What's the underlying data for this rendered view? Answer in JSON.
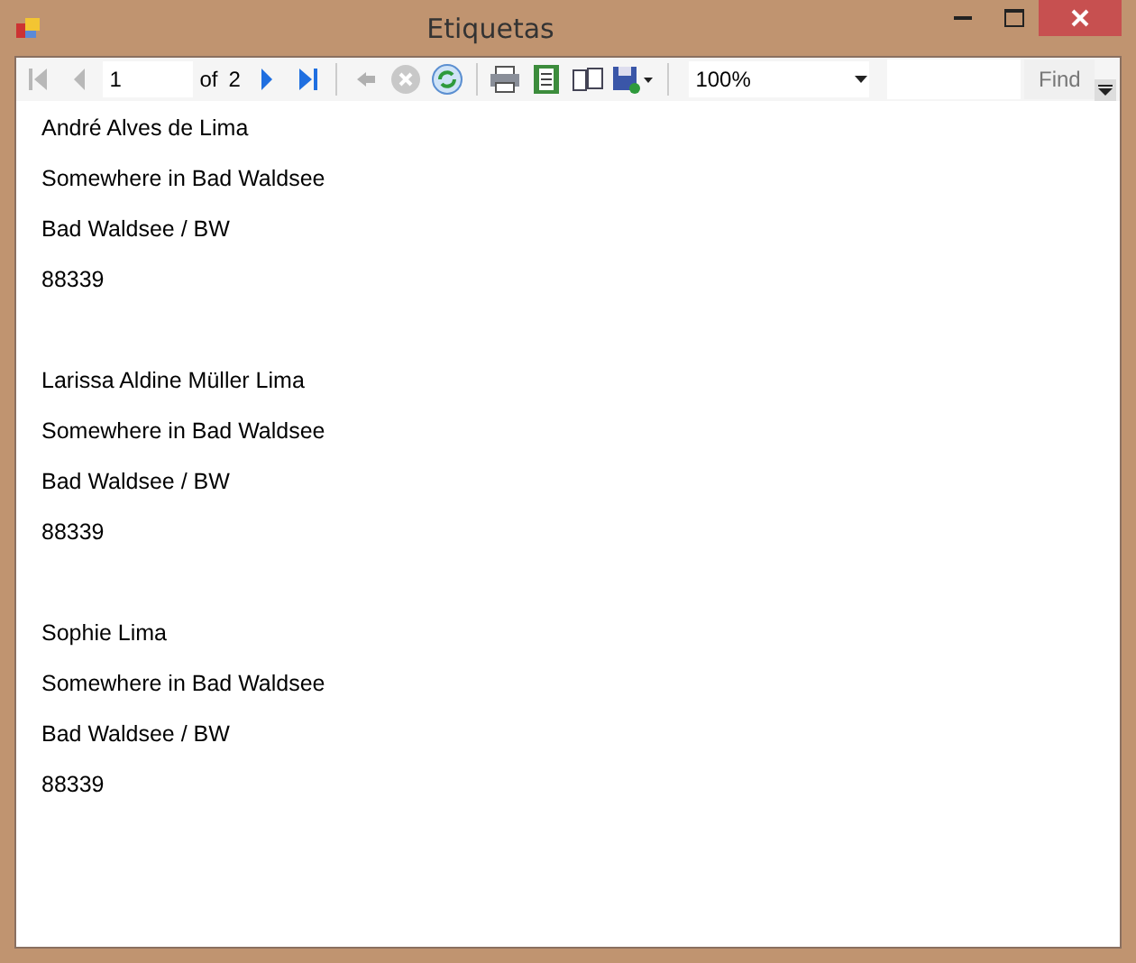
{
  "window": {
    "title": "Etiquetas"
  },
  "toolbar": {
    "nav_buttons": [
      {
        "kind": "first",
        "disabled": true
      },
      {
        "kind": "prev",
        "disabled": true
      }
    ],
    "page": {
      "value": "1",
      "of_label": "of",
      "count": "2"
    },
    "nav_buttons_after": [
      {
        "kind": "next",
        "disabled": false
      },
      {
        "kind": "last",
        "disabled": false
      }
    ],
    "action_buttons": [
      {
        "kind": "back",
        "disabled": true
      },
      {
        "kind": "stop",
        "disabled": true
      },
      {
        "kind": "refresh",
        "disabled": false
      }
    ],
    "zoom": {
      "value": "100%"
    },
    "find_button": "Find"
  },
  "labels": [
    {
      "lines": [
        "André Alves de Lima",
        "Somewhere in Bad Waldsee",
        "Bad Waldsee / BW",
        "88339"
      ]
    },
    {
      "lines": [
        "Larissa Aldine Müller Lima",
        "Somewhere in Bad Waldsee",
        "Bad Waldsee / BW",
        "88339"
      ]
    },
    {
      "lines": [
        "Sophie Lima",
        "Somewhere in Bad Waldsee",
        "Bad Waldsee / BW",
        "88339"
      ]
    }
  ]
}
